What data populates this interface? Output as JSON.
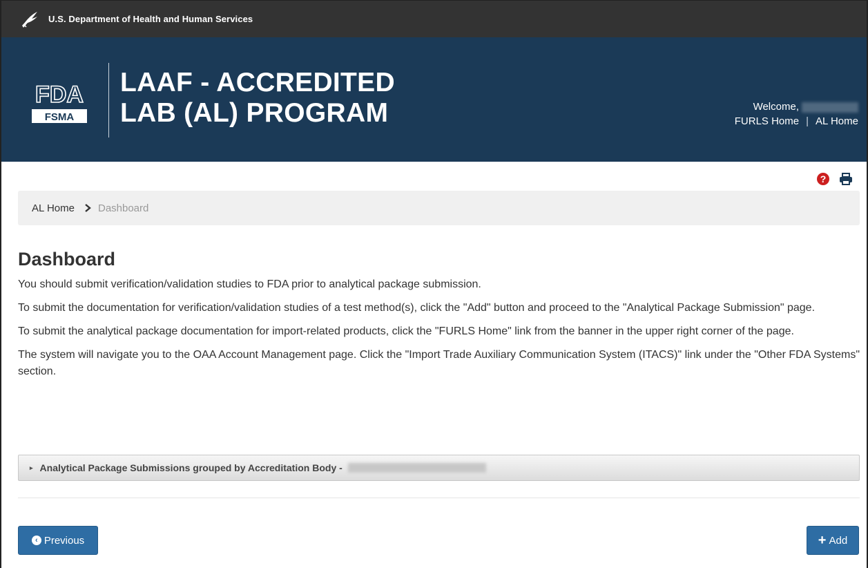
{
  "hhs_bar": {
    "text": "U.S. Department of Health and Human Services",
    "icon": "hhs-eagle-icon"
  },
  "banner": {
    "logo_top": "FDA",
    "logo_bottom": "FSMA",
    "title_line1": "LAAF - ACCREDITED",
    "title_line2": "LAB (AL) PROGRAM",
    "welcome": "Welcome,",
    "links": [
      "FURLS Home",
      "AL Home"
    ],
    "separator": "|"
  },
  "toolbar": {
    "help_icon": "question-circle-icon",
    "help_glyph": "?",
    "print_icon": "print-icon"
  },
  "breadcrumb": {
    "home": "AL Home",
    "current": "Dashboard"
  },
  "page": {
    "title": "Dashboard",
    "paragraphs": [
      "You should submit verification/validation studies to FDA prior to analytical package submission.",
      "To submit the documentation for verification/validation studies of a test method(s), click the \"Add\" button and proceed to the \"Analytical Package Submission\" page.",
      "To submit the analytical package documentation for import-related products, click the \"FURLS Home\" link from the banner in the upper right corner of the page.",
      "The system will navigate you to the OAA Account Management page. Click the \"Import Trade Auxiliary Communication System (ITACS)\" link under the \"Other FDA Systems\" section."
    ]
  },
  "accordion": {
    "caret": "▸",
    "label": "Analytical Package Submissions grouped by Accreditation Body -"
  },
  "buttons": {
    "previous": "Previous",
    "previous_glyph": "‹",
    "add": "Add",
    "add_glyph": "+"
  },
  "colors": {
    "hhs_bar": "#333333",
    "banner": "#1b3a57",
    "button": "#2e6da4",
    "help": "#cc1f1f"
  }
}
